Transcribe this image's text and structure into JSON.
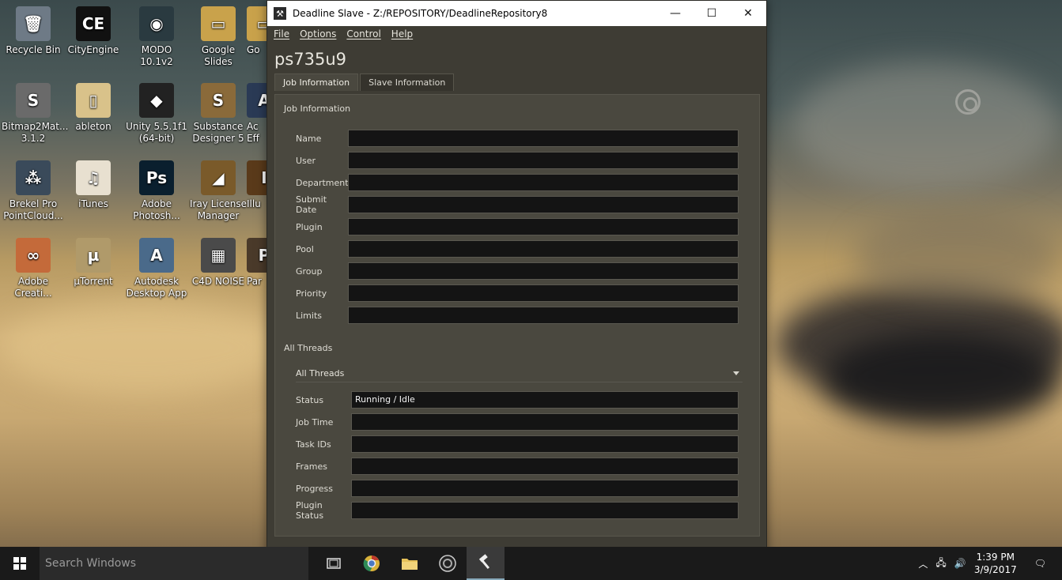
{
  "desktop": {
    "icons": [
      {
        "label": "Recycle Bin",
        "glyph": "🗑",
        "color": "#6e7a86"
      },
      {
        "label": "CityEngine",
        "glyph": "CE",
        "color": "#111111"
      },
      {
        "label": "MODO 10.1v2",
        "glyph": "◉",
        "color": "#2a3a40"
      },
      {
        "label": "Google Slides",
        "glyph": "▭",
        "color": "#c9a24b"
      },
      {
        "label": "Go",
        "glyph": "▭",
        "color": "#c9a24b"
      },
      {
        "label": "Bitmap2Mat...\n3.1.2",
        "glyph": "S",
        "color": "#6a6a6a"
      },
      {
        "label": "ableton",
        "glyph": "▯",
        "color": "#d9c28a"
      },
      {
        "label": "Unity 5.5.1f1\n(64-bit)",
        "glyph": "◆",
        "color": "#222222"
      },
      {
        "label": "Substance\nDesigner 5",
        "glyph": "S",
        "color": "#8a6a3a"
      },
      {
        "label": "Ac\nEff",
        "glyph": "A",
        "color": "#2a3a55"
      },
      {
        "label": "Brekel Pro\nPointCloud...",
        "glyph": "⁂",
        "color": "#3a4a5a"
      },
      {
        "label": "iTunes",
        "glyph": "♫",
        "color": "#e8e0d0"
      },
      {
        "label": "Adobe\nPhotosh...",
        "glyph": "Ps",
        "color": "#0a1f2e"
      },
      {
        "label": "Iray License\nManager",
        "glyph": "◢",
        "color": "#7a5a2a"
      },
      {
        "label": "Illu",
        "glyph": "I",
        "color": "#5a3a1a"
      },
      {
        "label": "Adobe\nCreati...",
        "glyph": "∞",
        "color": "#c46a3a"
      },
      {
        "label": "µTorrent",
        "glyph": "µ",
        "color": "#b09a6a"
      },
      {
        "label": "Autodesk\nDesktop App",
        "glyph": "A",
        "color": "#4a6a8a"
      },
      {
        "label": "C4D NOISE",
        "glyph": "▦",
        "color": "#4a4a4a"
      },
      {
        "label": "Par",
        "glyph": "P",
        "color": "#4a3a2a"
      }
    ]
  },
  "window": {
    "title": "Deadline Slave  -  Z:/REPOSITORY/DeadlineRepository8",
    "minimize": "—",
    "maximize": "☐",
    "close": "✕",
    "menu": [
      "File",
      "Options",
      "Control",
      "Help"
    ],
    "hostname": "ps735u9",
    "tabs": [
      "Job Information",
      "Slave Information"
    ],
    "job_group_title": "Job Information",
    "job_fields": [
      {
        "label": "Name",
        "value": ""
      },
      {
        "label": "User",
        "value": ""
      },
      {
        "label": "Department",
        "value": ""
      },
      {
        "label": "Submit Date",
        "value": ""
      },
      {
        "label": "Plugin",
        "value": ""
      },
      {
        "label": "Pool",
        "value": ""
      },
      {
        "label": "Group",
        "value": ""
      },
      {
        "label": "Priority",
        "value": ""
      },
      {
        "label": "Limits",
        "value": ""
      }
    ],
    "threads_group_title": "All Threads",
    "threads_selected": "All Threads",
    "thread_fields": [
      {
        "label": "Status",
        "value": "Running / Idle"
      },
      {
        "label": "Job Time",
        "value": ""
      },
      {
        "label": "Task IDs",
        "value": ""
      },
      {
        "label": "Frames",
        "value": ""
      },
      {
        "label": "Progress",
        "value": ""
      },
      {
        "label": "Plugin Status",
        "value": ""
      }
    ]
  },
  "taskbar": {
    "search_placeholder": "Search Windows",
    "clock_time": "1:39 PM",
    "clock_date": "3/9/2017"
  }
}
